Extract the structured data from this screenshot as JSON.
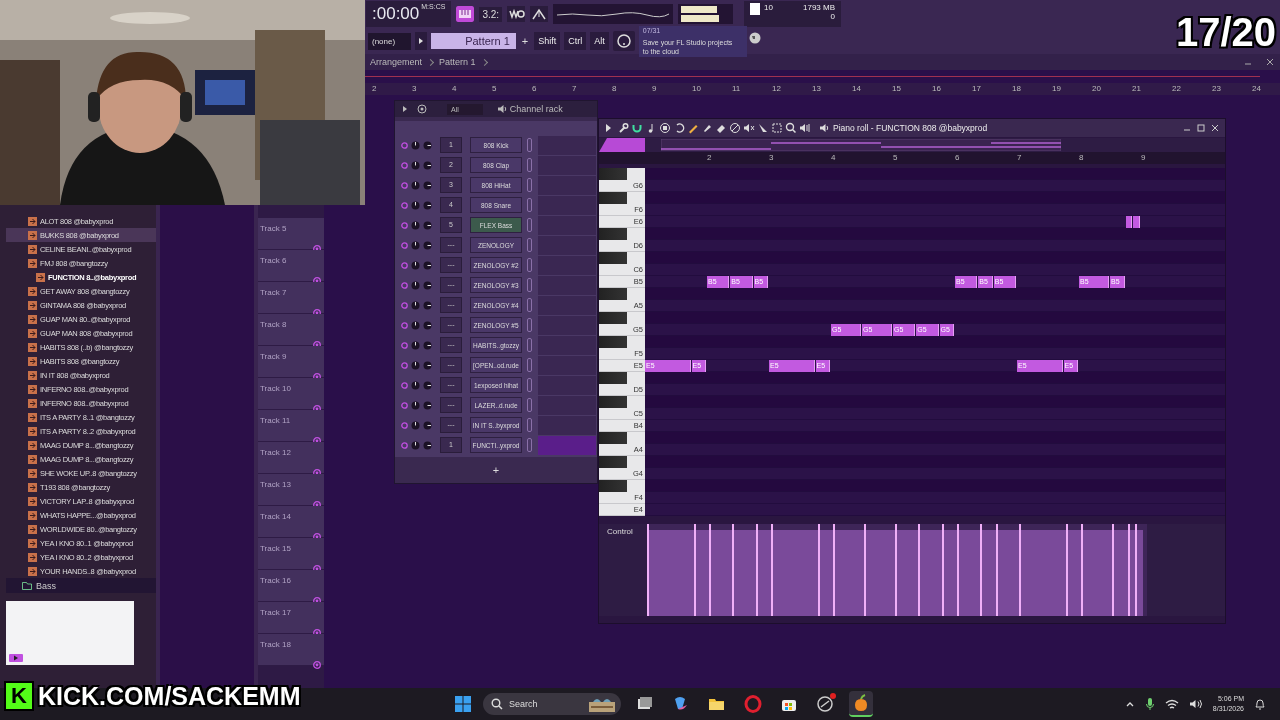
{
  "overlay": {
    "counter": "17/20",
    "logo": "K",
    "stream_link": "KICK.COM/SACKEMM"
  },
  "webcam": {
    "kind": "picture"
  },
  "toolbar": {
    "time": ":00:00",
    "time_format": "M:S:CS",
    "snap": "3.2:",
    "cpu": "10",
    "memory": "1793 MB",
    "polyphony": "0",
    "pattern_picker": "(none)",
    "pattern": "Pattern 1",
    "add_pattern": "+",
    "modifiers": [
      "Shift",
      "Ctrl",
      "Alt"
    ],
    "hint_counter": "07/31",
    "hint": "Save your FL Studio projects to the cloud"
  },
  "breadcrumb": [
    "Arrangement",
    "Pattern 1"
  ],
  "browser": {
    "items": [
      {
        "label": "ALOT 808 @babyxprod",
        "selected": false,
        "active": false
      },
      {
        "label": "BUKKS 808 @babyxprod",
        "selected": true,
        "active": false
      },
      {
        "label": "CELINE BEANI..@babyxprod",
        "selected": false,
        "active": false
      },
      {
        "label": "FMJ 808 @bangtozzy",
        "selected": false,
        "active": false
      },
      {
        "label": "FUNCTION 8..@babyxprod",
        "selected": false,
        "active": true
      },
      {
        "label": "GET AWAY 808 @bangtozzy",
        "selected": false,
        "active": false
      },
      {
        "label": "GINTAMA 808 @babyxprod",
        "selected": false,
        "active": false
      },
      {
        "label": "GUAP MAN 80..@babyxprod",
        "selected": false,
        "active": false
      },
      {
        "label": "GUAP MAN 808 @babyxprod",
        "selected": false,
        "active": false
      },
      {
        "label": "HABITS 808 (..b) @bangtozzy",
        "selected": false,
        "active": false
      },
      {
        "label": "HABITS 808 @bangtozzy",
        "selected": false,
        "active": false
      },
      {
        "label": "IN IT 808 @babyxprod",
        "selected": false,
        "active": false
      },
      {
        "label": "INFERNO 808..@babyxprod",
        "selected": false,
        "active": false
      },
      {
        "label": "INFERNO 808..@babyxprod",
        "selected": false,
        "active": false
      },
      {
        "label": "ITS A PARTY 8..1 @bangtozzy",
        "selected": false,
        "active": false
      },
      {
        "label": "ITS A PARTY 8..2 @babyxprod",
        "selected": false,
        "active": false
      },
      {
        "label": "MAAG DUMP 8...@bangtozzy",
        "selected": false,
        "active": false
      },
      {
        "label": "MAAG DUMP 8...@bangtozzy",
        "selected": false,
        "active": false
      },
      {
        "label": "SHE WOKE UP..8 @bangtozzy",
        "selected": false,
        "active": false
      },
      {
        "label": "T193 808 @bangtozzy",
        "selected": false,
        "active": false
      },
      {
        "label": "VICTORY LAP..8 @babyxprod",
        "selected": false,
        "active": false
      },
      {
        "label": "WHATS HAPPE...@babyxprod",
        "selected": false,
        "active": false
      },
      {
        "label": "WORLDWIDE 80..@bangtozzy",
        "selected": false,
        "active": false
      },
      {
        "label": "YEA I KNO 80..1 @babyxprod",
        "selected": false,
        "active": false
      },
      {
        "label": "YEA I KNO 80..2 @babyxprod",
        "selected": false,
        "active": false
      },
      {
        "label": "YOUR HANDS..8 @babyxprod",
        "selected": false,
        "active": false
      }
    ],
    "folder": "Bass"
  },
  "playlist": {
    "ruler": [
      "2",
      "3",
      "4",
      "5",
      "6",
      "7",
      "8",
      "9",
      "10",
      "11",
      "12",
      "13",
      "14",
      "15",
      "16",
      "17",
      "18",
      "19",
      "20",
      "21",
      "22",
      "23",
      "24"
    ],
    "tracks": [
      "Track 5",
      "Track 6",
      "Track 7",
      "Track 8",
      "Track 9",
      "Track 10",
      "Track 11",
      "Track 12",
      "Track 13",
      "Track 14",
      "Track 15",
      "Track 16",
      "Track 17",
      "Track 18"
    ]
  },
  "channel_rack": {
    "title": "Channel rack",
    "filter": "All",
    "add": "+",
    "channels": [
      {
        "number": "1",
        "name": "808 Kick",
        "highlighted": false,
        "selected": false
      },
      {
        "number": "2",
        "name": "808 Clap",
        "highlighted": false,
        "selected": false
      },
      {
        "number": "3",
        "name": "808 HiHat",
        "highlighted": false,
        "selected": false
      },
      {
        "number": "4",
        "name": "808 Snare",
        "highlighted": false,
        "selected": false
      },
      {
        "number": "5",
        "name": "FLEX Bass",
        "highlighted": true,
        "selected": false
      },
      {
        "number": "---",
        "name": "ZENOLOGY",
        "highlighted": false,
        "selected": false
      },
      {
        "number": "---",
        "name": "ZENOLOGY #2",
        "highlighted": false,
        "selected": false
      },
      {
        "number": "---",
        "name": "ZENOLOGY #3",
        "highlighted": false,
        "selected": false
      },
      {
        "number": "---",
        "name": "ZENOLOGY #4",
        "highlighted": false,
        "selected": false
      },
      {
        "number": "---",
        "name": "ZENOLOGY #5",
        "highlighted": false,
        "selected": false
      },
      {
        "number": "---",
        "name": "HABITS..gtozzy",
        "highlighted": false,
        "selected": false
      },
      {
        "number": "---",
        "name": "[OPEN..od.rude",
        "highlighted": false,
        "selected": false
      },
      {
        "number": "---",
        "name": "1exposed hihat",
        "highlighted": false,
        "selected": false
      },
      {
        "number": "---",
        "name": "LAZER..d.rude",
        "highlighted": false,
        "selected": false
      },
      {
        "number": "---",
        "name": "IN IT S..byxprod",
        "highlighted": false,
        "selected": false
      },
      {
        "number": "1",
        "name": "FUNCTI..yxprod",
        "highlighted": false,
        "selected": true
      }
    ]
  },
  "piano_roll": {
    "title": "Piano roll - FUNCTION 808 @babyxprod",
    "ruler": [
      "2",
      "3",
      "4",
      "5",
      "6",
      "7",
      "8",
      "9"
    ],
    "control": "Control",
    "keys": [
      {
        "kind": "black"
      },
      {
        "kind": "white",
        "label": "G6"
      },
      {
        "kind": "black"
      },
      {
        "kind": "white",
        "label": "F6"
      },
      {
        "kind": "white",
        "label": "E6",
        "notes": [
          {
            "selected": false
          },
          {
            "selected": false
          }
        ]
      },
      {
        "kind": "black"
      },
      {
        "kind": "white",
        "label": "D6"
      },
      {
        "kind": "black"
      },
      {
        "kind": "white",
        "label": "C6"
      },
      {
        "kind": "white",
        "label": "B5",
        "notes": [
          {
            "label": "B5",
            "selected": false
          },
          {
            "label": "B5",
            "selected": false
          },
          {
            "label": "B5",
            "selected": false
          },
          {
            "label": "B5",
            "selected": false
          },
          {
            "label": "B5",
            "selected": false
          },
          {
            "label": "B5",
            "selected": false
          },
          {
            "label": "B5",
            "selected": false
          },
          {
            "label": "B5",
            "selected": false
          }
        ]
      },
      {
        "kind": "black"
      },
      {
        "kind": "white",
        "label": "A5"
      },
      {
        "kind": "black"
      },
      {
        "kind": "white",
        "label": "G5",
        "notes": [
          {
            "label": "G5",
            "selected": false
          },
          {
            "label": "G5",
            "selected": false
          },
          {
            "label": "G5",
            "selected": false
          },
          {
            "label": "G5",
            "selected": false
          },
          {
            "label": "G5",
            "selected": false
          }
        ]
      },
      {
        "kind": "black"
      },
      {
        "kind": "white",
        "label": "F5"
      },
      {
        "kind": "white",
        "label": "E5",
        "notes": [
          {
            "label": "E5",
            "selected": false
          },
          {
            "label": "E5",
            "selected": false
          },
          {
            "label": "E5",
            "selected": false
          },
          {
            "label": "E5",
            "selected": false
          },
          {
            "label": "E5",
            "selected": false
          },
          {
            "label": "E5",
            "selected": false
          }
        ]
      },
      {
        "kind": "black"
      },
      {
        "kind": "white",
        "label": "D5"
      },
      {
        "kind": "black"
      },
      {
        "kind": "white",
        "label": "C5"
      },
      {
        "kind": "white",
        "label": "B4"
      },
      {
        "kind": "black"
      },
      {
        "kind": "white",
        "label": "A4"
      },
      {
        "kind": "black"
      },
      {
        "kind": "white",
        "label": "G4"
      },
      {
        "kind": "black"
      },
      {
        "kind": "white",
        "label": "F4"
      },
      {
        "kind": "white",
        "label": "E4"
      }
    ]
  },
  "taskbar": {
    "search": "Search",
    "apps": [
      {
        "kind": "taskview",
        "active": false,
        "badge": false
      },
      {
        "kind": "copilot",
        "active": false,
        "badge": false
      },
      {
        "kind": "folder",
        "active": false,
        "badge": false
      },
      {
        "kind": "opera",
        "active": false,
        "badge": false
      },
      {
        "kind": "store",
        "active": false,
        "badge": false
      },
      {
        "kind": "sync",
        "active": false,
        "badge": true
      },
      {
        "kind": "fruit",
        "active": true,
        "badge": false
      }
    ],
    "time": "5:06 PM",
    "date": "8/31/2026"
  }
}
